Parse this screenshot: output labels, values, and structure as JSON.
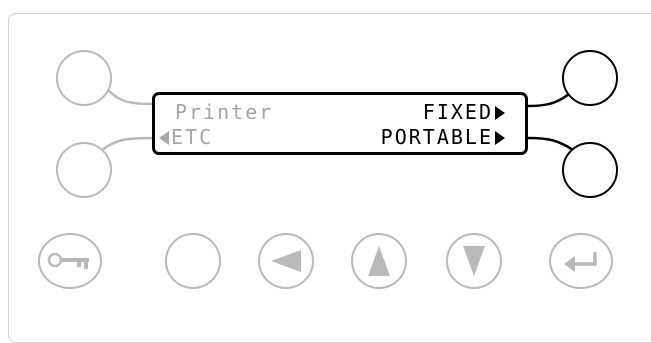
{
  "display": {
    "line1_left": "Printer",
    "line1_right": "FIXED",
    "line2_left": "ETC",
    "line2_right": "PORTABLE"
  },
  "icons": {
    "key": "key-icon",
    "blank": "blank-button",
    "left": "left-triangle-icon",
    "up": "up-triangle-icon",
    "down": "down-triangle-icon",
    "enter": "enter-icon"
  },
  "colors": {
    "active": "#000000",
    "inactive": "#b9b9b9",
    "dim_text": "#a6a6a6"
  }
}
